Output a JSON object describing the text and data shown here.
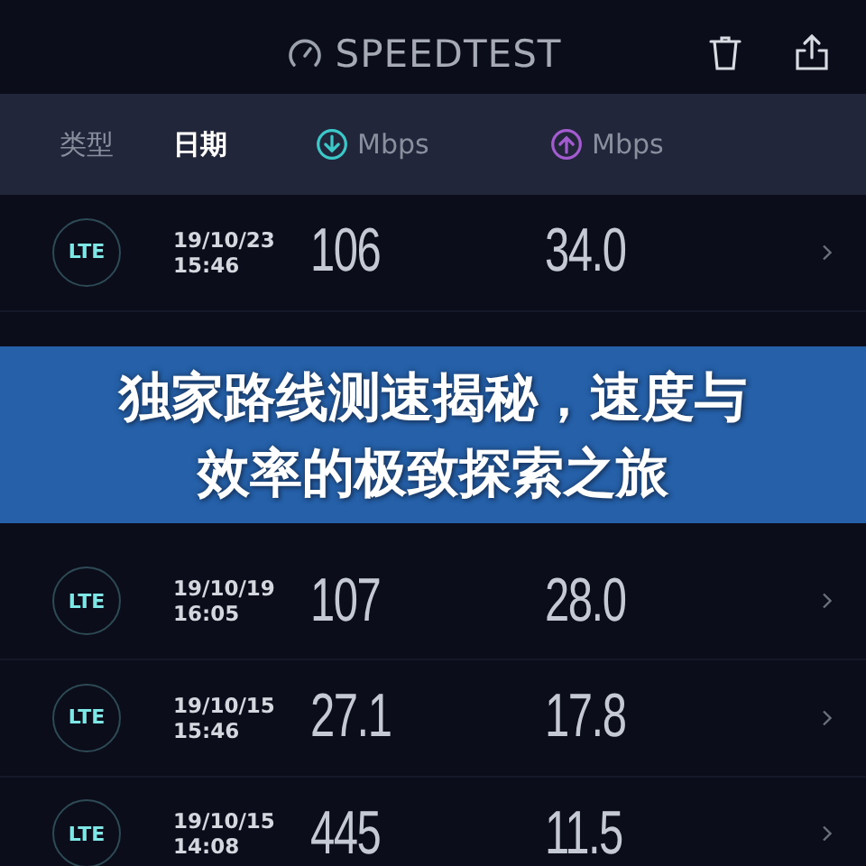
{
  "header": {
    "title": "SPEEDTEST"
  },
  "columns": [
    {
      "kind": "text",
      "label": "类型",
      "selected": false
    },
    {
      "kind": "text",
      "label": "日期",
      "selected": true
    },
    {
      "kind": "download",
      "label": "Mbps",
      "selected": false
    },
    {
      "kind": "upload",
      "label": "Mbps",
      "selected": false
    }
  ],
  "rows": [
    {
      "type": "LTE",
      "date": "19/10/23",
      "time": "15:46",
      "download": "106",
      "upload": "34.0"
    },
    {
      "type": "LTE",
      "date": "19/10/19",
      "time": "16:05",
      "download": "107",
      "upload": "28.0"
    },
    {
      "type": "LTE",
      "date": "19/10/15",
      "time": "15:46",
      "download": "27.1",
      "upload": "17.8"
    },
    {
      "type": "LTE",
      "date": "19/10/15",
      "time": "14:08",
      "download": "445",
      "upload": "11.5"
    }
  ],
  "banner": {
    "title": "独家路线测速揭秘，速度与效率的极致探索之旅"
  }
}
